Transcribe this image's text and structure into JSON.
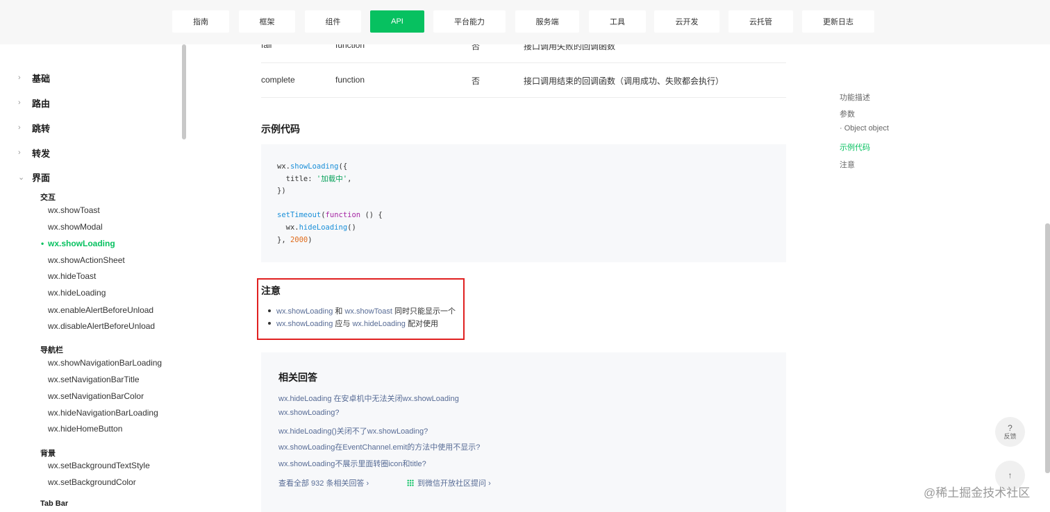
{
  "topnav": {
    "tabs": [
      "指南",
      "框架",
      "组件",
      "API",
      "平台能力",
      "服务端",
      "工具",
      "云开发",
      "云托管",
      "更新日志"
    ],
    "active": "API"
  },
  "sidebar": {
    "categories": [
      "基础",
      "路由",
      "跳转",
      "转发",
      "界面"
    ],
    "expanded": "界面",
    "groups": {
      "interaction": "交互",
      "navbar": "导航栏",
      "background": "背景",
      "tabbar": "Tab Bar"
    },
    "interaction_items": [
      "wx.showToast",
      "wx.showModal",
      "wx.showLoading",
      "wx.showActionSheet",
      "wx.hideToast",
      "wx.hideLoading",
      "wx.enableAlertBeforeUnload",
      "wx.disableAlertBeforeUnload"
    ],
    "navbar_items": [
      "wx.showNavigationBarLoading",
      "wx.setNavigationBarTitle",
      "wx.setNavigationBarColor",
      "wx.hideNavigationBarLoading",
      "wx.hideHomeButton"
    ],
    "background_items": [
      "wx.setBackgroundTextStyle",
      "wx.setBackgroundColor"
    ],
    "active_item": "wx.showLoading"
  },
  "params_table": {
    "rows": [
      {
        "name": "fail",
        "type": "function",
        "required": "否",
        "desc": "接口调用失败的回调函数"
      },
      {
        "name": "complete",
        "type": "function",
        "required": "否",
        "desc": "接口调用结束的回调函数（调用成功、失败都会执行）"
      }
    ]
  },
  "example": {
    "heading": "示例代码",
    "code": {
      "l1_obj": "wx.",
      "l1_fn": "showLoading",
      "l1_end": "({",
      "l2_key": "  title: ",
      "l2_str": "'加载中'",
      "l2_end": ",",
      "l3": "})",
      "l5_fn": "setTimeout",
      "l5_open": "(",
      "l5_kw": "function",
      "l5_end": " () {",
      "l6_obj": "  wx.",
      "l6_fn": "hideLoading",
      "l6_end": "()",
      "l7_start": "}, ",
      "l7_num": "2000",
      "l7_end": ")"
    }
  },
  "note": {
    "heading": "注意",
    "items": [
      {
        "a": "wx.showLoading",
        "mid": " 和 ",
        "b": "wx.showToast",
        "tail": " 同时只能显示一个"
      },
      {
        "a": "wx.showLoading",
        "mid": " 应与 ",
        "b": "wx.hideLoading",
        "tail": " 配对使用"
      }
    ]
  },
  "related": {
    "heading": "相关回答",
    "links": [
      "wx.hideLoading 在安卓机中无法关闭wx.showLoading",
      "wx.showLoading?",
      "wx.hideLoading()关闭不了wx.showLoading?",
      "wx.showLoading在EventChannel.emit的方法中使用不显示?",
      "wx.showLoading不展示里面转圈icon和title?"
    ],
    "view_all": "查看全部 932 条相关回答",
    "ask": "到微信开放社区提问",
    "arrow": "›"
  },
  "toc": {
    "items": [
      "功能描述",
      "参数",
      "· Object object",
      "示例代码",
      "注意"
    ],
    "active": "示例代码"
  },
  "feedback": {
    "icon": "?",
    "label": "反馈"
  },
  "back_top": {
    "icon": "↑"
  },
  "watermark": "@稀土掘金技术社区"
}
